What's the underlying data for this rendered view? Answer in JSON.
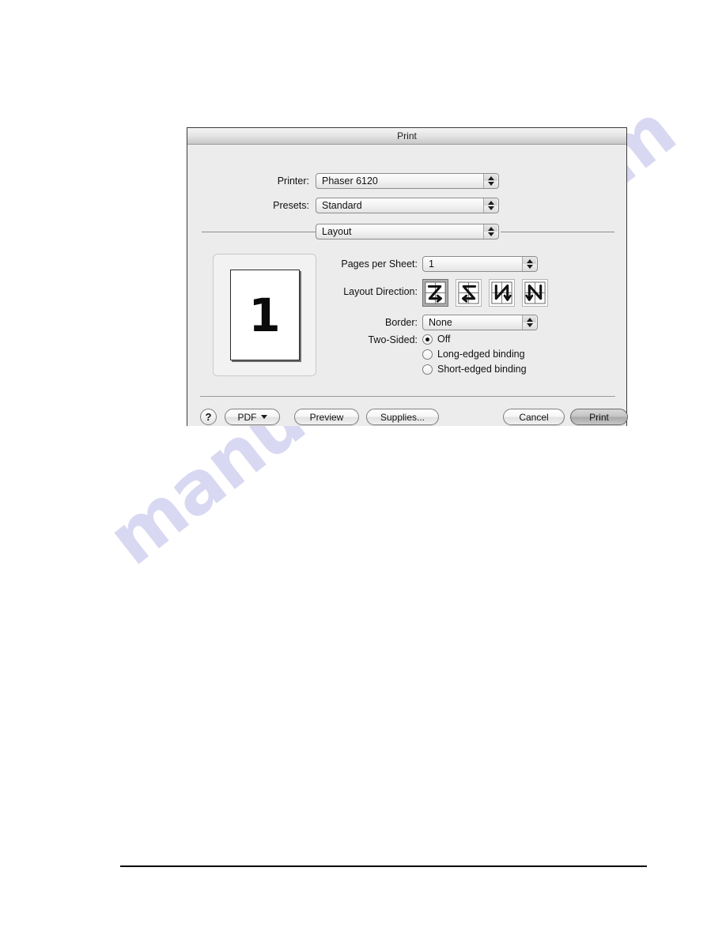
{
  "dialog": {
    "title": "Print",
    "fields": {
      "printer_label": "Printer:",
      "printer_value": "Phaser 6120",
      "presets_label": "Presets:",
      "presets_value": "Standard",
      "pane_value": "Layout",
      "pages_per_sheet_label": "Pages per Sheet:",
      "pages_per_sheet_value": "1",
      "layout_direction_label": "Layout Direction:",
      "border_label": "Border:",
      "border_value": "None",
      "two_sided_label": "Two-Sided:"
    },
    "preview": {
      "page_number": "1"
    },
    "layout_directions": [
      {
        "name": "z-across-then-down",
        "selected": true
      },
      {
        "name": "z-reverse-across-then-down",
        "selected": false
      },
      {
        "name": "n-down-then-across",
        "selected": false
      },
      {
        "name": "n-reverse-down-then-across",
        "selected": false
      }
    ],
    "two_sided_options": [
      {
        "label": "Off",
        "checked": true
      },
      {
        "label": "Long-edged binding",
        "checked": false
      },
      {
        "label": "Short-edged binding",
        "checked": false
      }
    ],
    "buttons": {
      "help": "?",
      "pdf": "PDF",
      "preview": "Preview",
      "supplies": "Supplies...",
      "cancel": "Cancel",
      "print": "Print"
    }
  },
  "watermark": {
    "text": "manualshive.com"
  }
}
